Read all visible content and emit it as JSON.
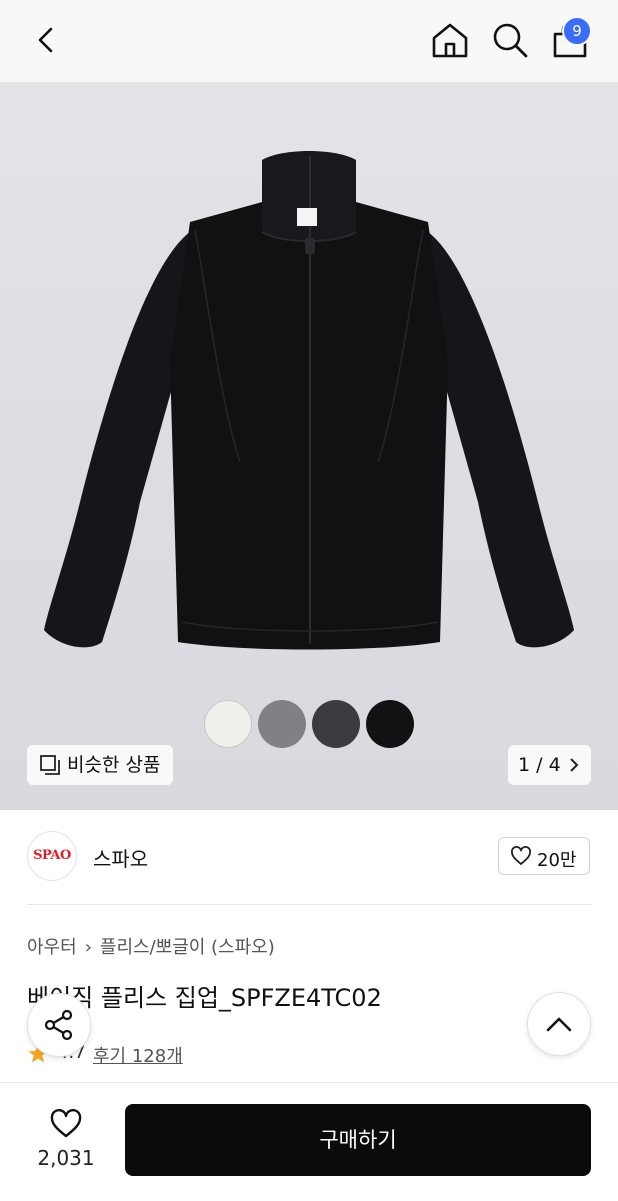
{
  "header": {
    "back_icon": "chevron-left-icon",
    "home_icon": "home-icon",
    "search_icon": "search-icon",
    "bag_icon": "shopping-bag-icon",
    "bag_badge_count": "9",
    "badge_color": "#3b6cf6"
  },
  "gallery": {
    "current_page": "1 / 4",
    "similar_label": "비슷한 상품",
    "color_swatches": [
      "#f1efeb",
      "#7f8185",
      "#3b3c3f",
      "#121214"
    ],
    "selected_swatch_index": 3
  },
  "brand": {
    "logo_text": "SPAO",
    "logo_color": "#d92128",
    "name": "스파오",
    "likes": "20만"
  },
  "product": {
    "breadcrumb": [
      "아우터",
      "플리스/뽀글이 (스파오)"
    ],
    "title": "베이직 플리스 집업_SPFZE4TC02",
    "rating": "4.7",
    "reviews": "후기 128개",
    "star_color": "#f5a623"
  },
  "bottom_bar": {
    "wish_count": "2,031",
    "buy_label": "구매하기"
  }
}
